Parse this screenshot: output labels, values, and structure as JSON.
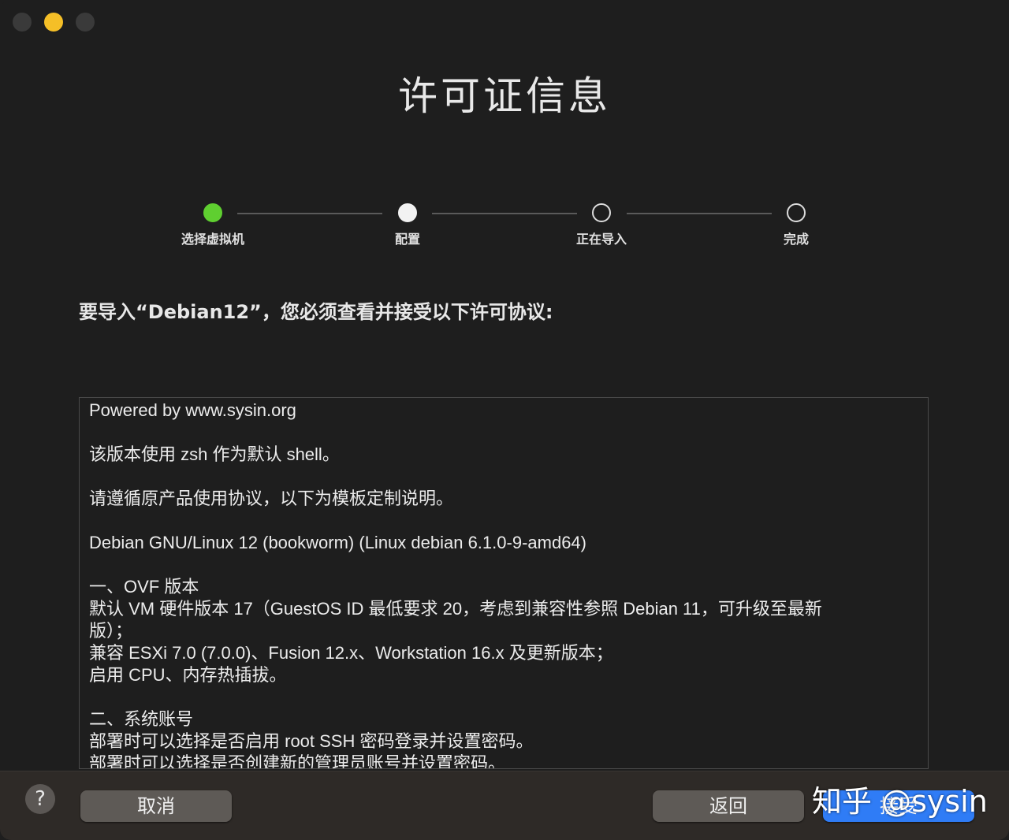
{
  "window": {
    "title": "许可证信息"
  },
  "steps": [
    {
      "label": "选择虚拟机",
      "state": "done"
    },
    {
      "label": "配置",
      "state": "current"
    },
    {
      "label": "正在导入",
      "state": "pending"
    },
    {
      "label": "完成",
      "state": "pending"
    }
  ],
  "prompt": "要导入“Debian12”，您必须查看并接受以下许可协议:",
  "license": {
    "lines": [
      "Powered by www.sysin.org",
      "",
      "该版本使用 zsh 作为默认 shell。",
      "",
      "请遵循原产品使用协议，以下为模板定制说明。",
      "",
      "Debian GNU/Linux 12 (bookworm) (Linux debian 6.1.0-9-amd64)",
      "",
      "一、OVF 版本",
      "默认 VM 硬件版本 17（GuestOS ID 最低要求 20，考虑到兼容性参照 Debian 11，可升级至最新",
      "版）；",
      "兼容 ESXi 7.0 (7.0.0)、Fusion 12.x、Workstation 16.x 及更新版本；",
      "启用 CPU、内存热插拔。",
      "",
      "二、系统账号",
      "部署时可以选择是否启用 root SSH 密码登录并设置密码。",
      "部署时可以选择是否创建新的管理员账号并设置密码。"
    ]
  },
  "footer": {
    "help_label": "?",
    "cancel_label": "取消",
    "back_label": "返回",
    "accept_label": "接受"
  },
  "watermark": "知乎 @sysin",
  "colors": {
    "background": "#1e1e1e",
    "done_step": "#5fcf30",
    "accept_button": "#2f7cf6",
    "minimize_button": "#f5bf27"
  }
}
